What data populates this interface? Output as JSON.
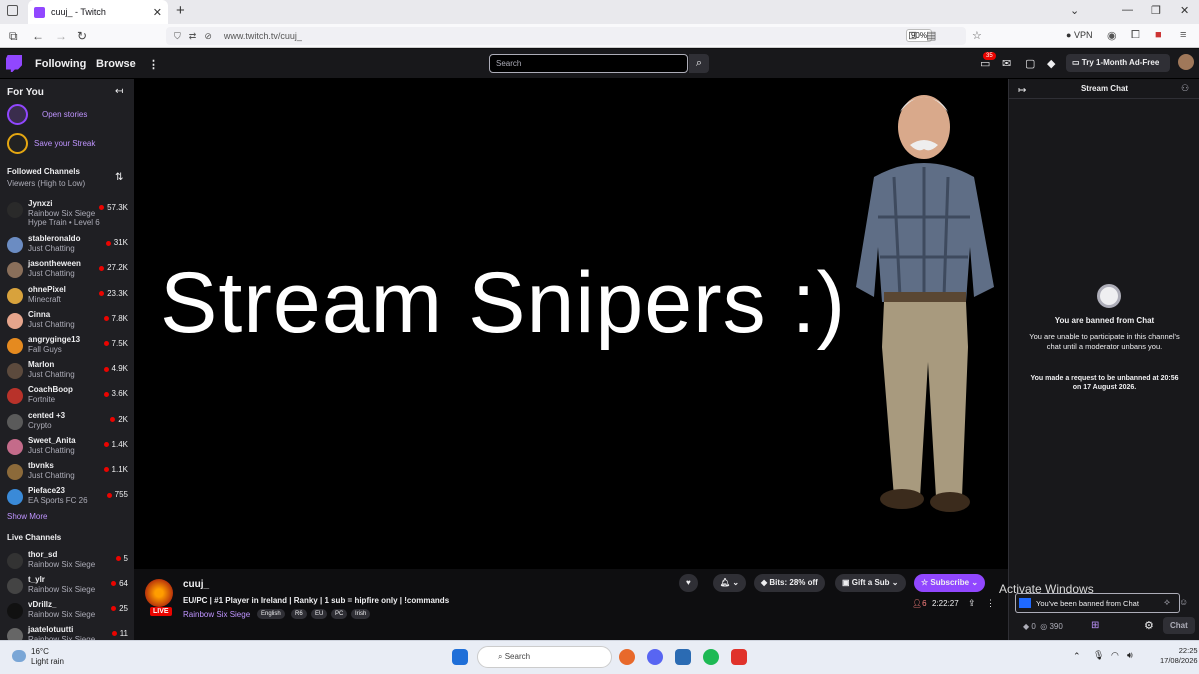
{
  "browser": {
    "tab_title": "cuuj_ - Twitch",
    "url": "www.twitch.tv/cuuj_",
    "zoom": "90%",
    "vpn_label": "VPN"
  },
  "twitch_nav": {
    "following": "Following",
    "browse": "Browse",
    "search_placeholder": "Search",
    "notifications_count": "35",
    "ad_free": "Try 1-Month Ad-Free"
  },
  "sidebar": {
    "for_you": "For You",
    "open_stories": "Open stories",
    "save_streak": "Save your Streak",
    "followed_heading": "Followed Channels",
    "followed_sort": "Viewers (High to Low)",
    "show_more": "Show More",
    "live_heading": "Live Channels",
    "followed": [
      {
        "name": "Jynxzi",
        "game": "Rainbow Six Siege",
        "viewers": "57.3K",
        "extra": "Hype Train • Level 6",
        "color": "#2a2a2a"
      },
      {
        "name": "stableronaldo",
        "game": "Just Chatting",
        "viewers": "31K",
        "color": "#6b8cc2"
      },
      {
        "name": "jasontheween",
        "game": "Just Chatting",
        "viewers": "27.2K",
        "color": "#8a6f5a"
      },
      {
        "name": "ohnePixel",
        "game": "Minecraft",
        "viewers": "23.3K",
        "color": "#d8a23c"
      },
      {
        "name": "Cinna",
        "game": "Just Chatting",
        "viewers": "7.8K",
        "color": "#e6a58c"
      },
      {
        "name": "angryginge13",
        "game": "Fall Guys",
        "viewers": "7.5K",
        "color": "#e58a1f"
      },
      {
        "name": "Marlon",
        "game": "Just Chatting",
        "viewers": "4.9K",
        "color": "#5c4a3d"
      },
      {
        "name": "CoachBoop",
        "game": "Fortnite",
        "viewers": "3.6K",
        "color": "#b8322a"
      },
      {
        "name": "cented +3",
        "game": "Crypto",
        "viewers": "2K",
        "color": "#5a5a5a"
      },
      {
        "name": "Sweet_Anita",
        "game": "Just Chatting",
        "viewers": "1.4K",
        "color": "#c46b8a"
      },
      {
        "name": "tbvnks",
        "game": "Just Chatting",
        "viewers": "1.1K",
        "color": "#8c6a3a"
      },
      {
        "name": "Pieface23",
        "game": "EA Sports FC 26",
        "viewers": "755",
        "color": "#3a8ad8"
      }
    ],
    "live": [
      {
        "name": "thor_sd",
        "game": "Rainbow Six Siege",
        "viewers": "5",
        "color": "#333"
      },
      {
        "name": "t_ylr",
        "game": "Rainbow Six Siege",
        "viewers": "64",
        "color": "#444"
      },
      {
        "name": "vDrillz_",
        "game": "Rainbow Six Siege",
        "viewers": "25",
        "color": "#111"
      },
      {
        "name": "jaatelotuutti",
        "game": "Rainbow Six Siege",
        "viewers": "11",
        "color": "#666"
      }
    ]
  },
  "player": {
    "overlay_text": "Stream Snipers :)"
  },
  "stream_info": {
    "live_badge": "LIVE",
    "streamer": "cuuj_",
    "title": "EU/PC | #1 Player in Ireland | Ranky | 1 sub = hipfire only | !commands",
    "game": "Rainbow Six Siege",
    "tags": [
      "English",
      "R6",
      "EU",
      "PC",
      "Irish"
    ],
    "bits": "Bits: 28% off",
    "gift_sub": "Gift a Sub",
    "subscribe": "Subscribe",
    "viewers": "6",
    "uptime": "2:22:27"
  },
  "chat": {
    "heading": "Stream Chat",
    "ban_title": "You are banned from Chat",
    "ban_body": "You are unable to participate in this channel's chat until a moderator unbans you.",
    "ban_request": "You made a request to be unbanned at 20:56 on 17 August 2026.",
    "input_text": "You've been banned from Chat",
    "points_a": "0",
    "points_b": "390",
    "chat_button": "Chat",
    "activate_windows": "Activate Windows"
  },
  "taskbar": {
    "temp": "16°C",
    "weather": "Light rain",
    "search": "Search",
    "time": "22:25",
    "date": "17/08/2026"
  }
}
